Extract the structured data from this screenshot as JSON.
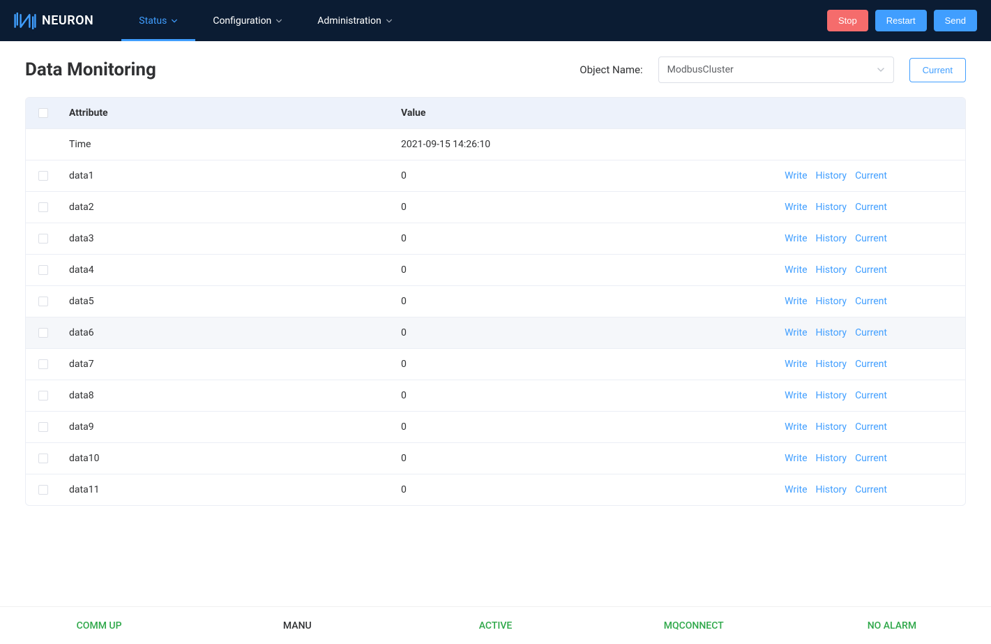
{
  "brand": "NEURON",
  "nav": {
    "items": [
      {
        "label": "Status",
        "active": true
      },
      {
        "label": "Configuration",
        "active": false
      },
      {
        "label": "Administration",
        "active": false
      }
    ]
  },
  "header_buttons": {
    "stop": "Stop",
    "restart": "Restart",
    "send": "Send"
  },
  "page": {
    "title": "Data Monitoring",
    "object_name_label": "Object Name:",
    "object_name_value": "ModbusCluster",
    "current_button": "Current"
  },
  "table": {
    "headers": {
      "attribute": "Attribute",
      "value": "Value"
    },
    "time_row": {
      "attribute": "Time",
      "value": "2021-09-15 14:26:10"
    },
    "action_labels": {
      "write": "Write",
      "history": "History",
      "current": "Current"
    },
    "rows": [
      {
        "attribute": "data1",
        "value": "0"
      },
      {
        "attribute": "data2",
        "value": "0"
      },
      {
        "attribute": "data3",
        "value": "0"
      },
      {
        "attribute": "data4",
        "value": "0"
      },
      {
        "attribute": "data5",
        "value": "0"
      },
      {
        "attribute": "data6",
        "value": "0",
        "hover": true
      },
      {
        "attribute": "data7",
        "value": "0"
      },
      {
        "attribute": "data8",
        "value": "0"
      },
      {
        "attribute": "data9",
        "value": "0"
      },
      {
        "attribute": "data10",
        "value": "0"
      },
      {
        "attribute": "data11",
        "value": "0"
      }
    ]
  },
  "footer": {
    "items": [
      {
        "label": "COMM UP",
        "class": "status-green"
      },
      {
        "label": "MANU",
        "class": "status-black"
      },
      {
        "label": "ACTIVE",
        "class": "status-green"
      },
      {
        "label": "MQCONNECT",
        "class": "status-green"
      },
      {
        "label": "NO ALARM",
        "class": "status-green"
      }
    ]
  }
}
